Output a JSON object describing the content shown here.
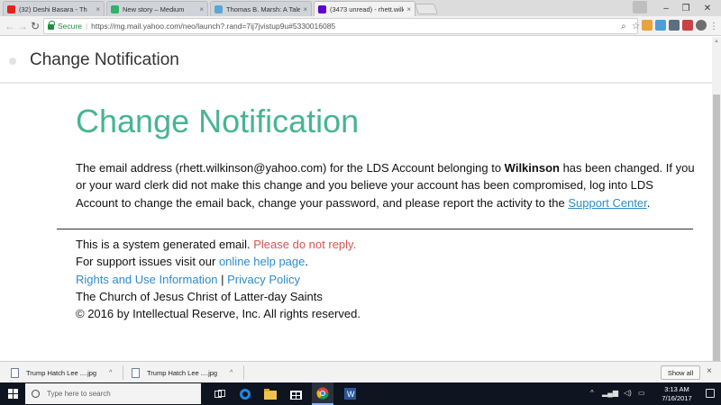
{
  "browser": {
    "tabs": [
      {
        "title": "(32) Deshi Basara - Th",
        "favicon_color": "#e62117"
      },
      {
        "title": "New story – Medium",
        "favicon_color": "#2fb26a"
      },
      {
        "title": "Thomas B. Marsh: A Tale",
        "favicon_color": "#5aa6d6"
      },
      {
        "title": "(3473 unread) - rhett.wilk",
        "favicon_color": "#5f01d1"
      }
    ],
    "secure_label": "Secure",
    "url": "https://mg.mail.yahoo.com/neo/launch?.rand=7ij7jvistup9u#5330016085"
  },
  "page_header": {
    "title": "Change Notification"
  },
  "email": {
    "heading": "Change Notification",
    "body_1": "The email address (rhett.wilkinson@yahoo.com) for the LDS Account belonging to ",
    "body_bold": "Wilkinson",
    "body_2": " has been changed. If you or your ward clerk did not make this change and you believe your account has been compromised, log into LDS Account to change the email back, change your password, and please report the activity to the ",
    "support_link": "Support Center",
    "body_end": ".",
    "footer": {
      "system_text": "This is a system generated email. ",
      "no_reply": "Please do not reply.",
      "support_text": "For support issues visit our ",
      "help_link": "online help page",
      "help_end": ".",
      "rights_link": "Rights and Use Information",
      "divider": " | ",
      "privacy_link": "Privacy Policy",
      "church": "The Church of Jesus Christ of Latter-day Saints",
      "copyright": "© 2016 by Intellectual Reserve, Inc. All rights reserved."
    }
  },
  "downloads": {
    "items": [
      {
        "name": "Trump Hatch Lee ....jpg"
      },
      {
        "name": "Trump Hatch Lee ....jpg"
      }
    ],
    "show_all": "Show all"
  },
  "taskbar": {
    "search_placeholder": "Type here to search",
    "time": "3:13 AM",
    "date": "7/16/2017"
  },
  "colors": {
    "heading": "#47b58f",
    "link": "#2e8bc9",
    "no_reply": "#d9534f",
    "secure": "#1e8e3e"
  }
}
